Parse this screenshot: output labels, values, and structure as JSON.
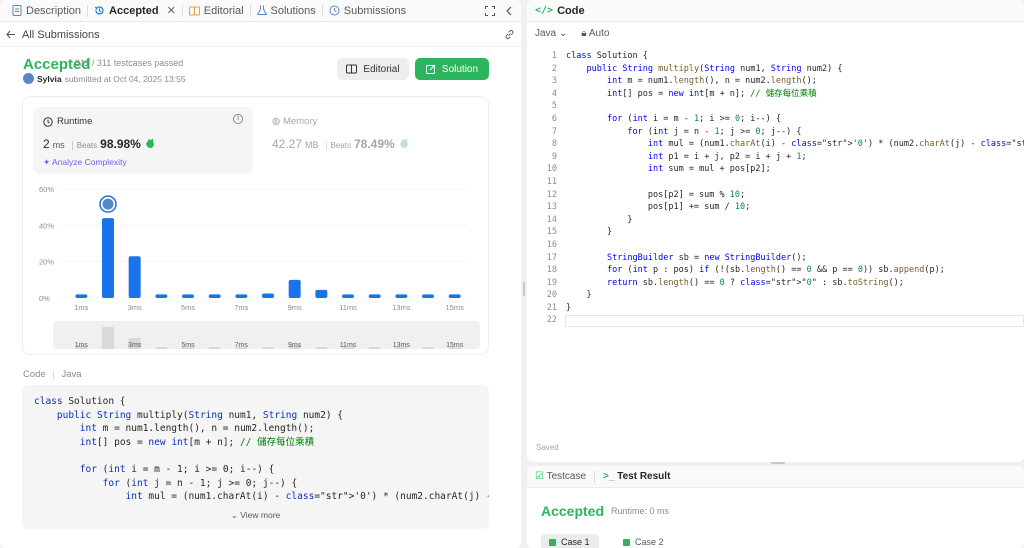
{
  "left_tabs": [
    {
      "label": "Description",
      "icon": "document-icon"
    },
    {
      "label": "Accepted",
      "icon": "history-icon"
    },
    {
      "label": "Editorial",
      "icon": "book-icon"
    },
    {
      "label": "Solutions",
      "icon": "flask-icon"
    },
    {
      "label": "Submissions",
      "icon": "clock-icon"
    }
  ],
  "back": {
    "label": "All Submissions"
  },
  "result": {
    "status": "Accepted",
    "testcases": "311 / 311 testcases passed",
    "user": "Sylvia",
    "submitted": "submitted at Oct 04, 2025 13:55"
  },
  "buttons": {
    "editorial": "Editorial",
    "solution": "Solution"
  },
  "runtime": {
    "title": "Runtime",
    "value": "2",
    "unit": "ms",
    "beats_label": "Beats",
    "beats": "98.98%",
    "analyze": "Analyze Complexity"
  },
  "memory": {
    "title": "Memory",
    "value": "42.27",
    "unit": "MB",
    "beats_label": "Beats",
    "beats": "78.49%"
  },
  "chart_data": {
    "type": "bar",
    "ylim": [
      0,
      60
    ],
    "yticks": [
      "0%",
      "20%",
      "40%",
      "60%"
    ],
    "x": [
      "1ms",
      "2ms",
      "3ms",
      "4ms",
      "5ms",
      "6ms",
      "7ms",
      "8ms",
      "9ms",
      "10ms",
      "11ms",
      "12ms",
      "13ms",
      "14ms",
      "15ms"
    ],
    "xticks": [
      "1ms",
      "3ms",
      "5ms",
      "7ms",
      "9ms",
      "11ms",
      "13ms",
      "15ms"
    ],
    "values": [
      2,
      44,
      23,
      2,
      2,
      2,
      2,
      2.5,
      10,
      4.5,
      2,
      2,
      2,
      2,
      2
    ],
    "highlight_index": 1,
    "highlight_color": "#1a73e8",
    "bar_color": "#1a73e8",
    "navigator_values": [
      2,
      12,
      6,
      1,
      1,
      1,
      1,
      1,
      2,
      1,
      1,
      1,
      1,
      1,
      1
    ]
  },
  "code_header": {
    "label": "Code",
    "lang": "Java"
  },
  "code_preview_lines": [
    "class Solution {",
    "    public String multiply(String num1, String num2) {",
    "        int m = num1.length(), n = num2.length();",
    "        int[] pos = new int[m + n]; // 儲存每位乘積",
    "",
    "        for (int i = m - 1; i >= 0; i--) {",
    "            for (int j = n - 1; j >= 0; j--) {",
    "                int mul = (num1.charAt(i) - '0') * (num2.charAt(j) - '0');"
  ],
  "view_more": "View more",
  "editor": {
    "title": "Code",
    "lang": "Java",
    "mode": "Auto",
    "saved": "Saved",
    "lines": [
      "class Solution {",
      "    public String multiply(String num1, String num2) {",
      "        int m = num1.length(), n = num2.length();",
      "        int[] pos = new int[m + n]; // 儲存每位乘積",
      "",
      "        for (int i = m - 1; i >= 0; i--) {",
      "            for (int j = n - 1; j >= 0; j--) {",
      "                int mul = (num1.charAt(i) - '0') * (num2.charAt(j) - '0');",
      "                int p1 = i + j, p2 = i + j + 1;",
      "                int sum = mul + pos[p2];",
      "",
      "                pos[p2] = sum % 10;",
      "                pos[p1] += sum / 10;",
      "            }",
      "        }",
      "",
      "        StringBuilder sb = new StringBuilder();",
      "        for (int p : pos) if (!(sb.length() == 0 && p == 0)) sb.append(p);",
      "        return sb.length() == 0 ? \"0\" : sb.toString();",
      "    }",
      "}",
      ""
    ]
  },
  "bottom": {
    "tabs": [
      "Testcase",
      "Test Result"
    ],
    "status": "Accepted",
    "runtime": "Runtime: 0 ms",
    "cases": [
      "Case 1",
      "Case 2"
    ]
  },
  "colors": {
    "accent": "#2db55d",
    "bar": "#1a73e8",
    "purple": "#7a5af8"
  }
}
